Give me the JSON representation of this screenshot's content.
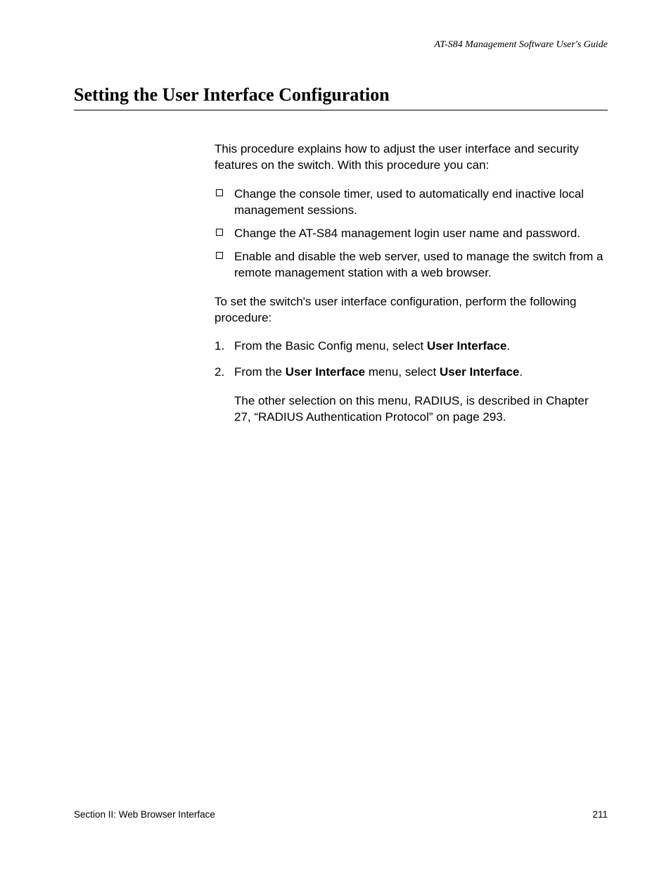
{
  "header": {
    "running_head": "AT-S84 Management Software User's Guide"
  },
  "title": "Setting the User Interface Configuration",
  "intro": "This procedure explains how to adjust the user interface and security features on the switch. With this procedure you can:",
  "bullets": [
    "Change the console timer, used to automatically end inactive local management sessions.",
    "Change the AT-S84 management login user name and password.",
    "Enable and disable the web server, used to manage the switch from a remote management station with a web browser."
  ],
  "pre_steps": "To set the switch's user interface configuration, perform the following procedure:",
  "steps": {
    "s1": {
      "num": "1.",
      "pre": "From the Basic Config menu, select ",
      "bold": "User Interface",
      "post": "."
    },
    "s2": {
      "num": "2.",
      "pre": "From the ",
      "bold1": "User Interface",
      "mid": " menu, select ",
      "bold2": "User Interface",
      "post": ".",
      "after": "The other selection on this menu, RADIUS, is described in Chapter 27, “RADIUS Authentication Protocol” on page 293."
    }
  },
  "footer": {
    "left": "Section II: Web Browser Interface",
    "right": "211"
  }
}
